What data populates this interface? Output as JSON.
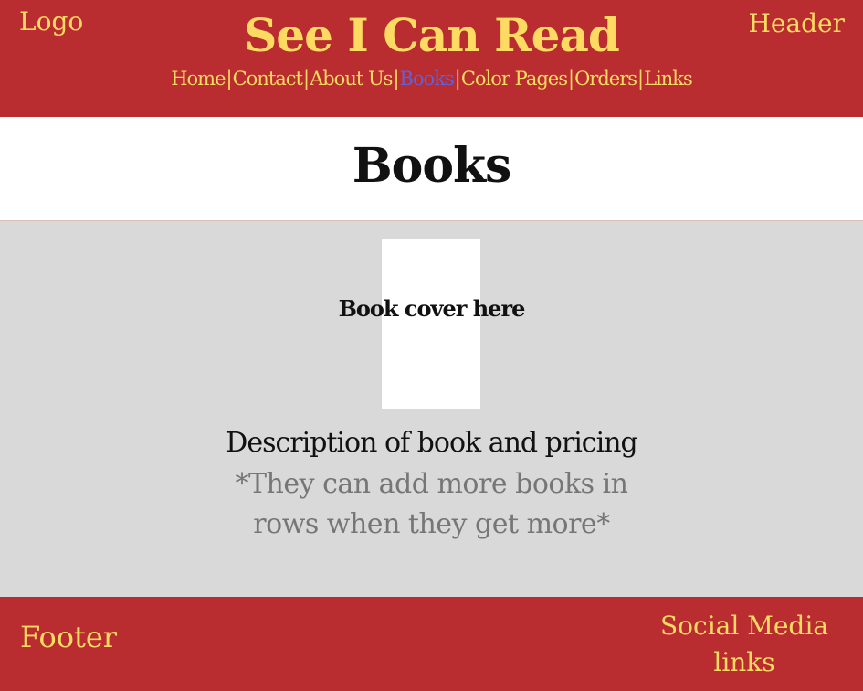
{
  "colors": {
    "header_bg": "#b92c2f",
    "accent_yellow": "#fddb63",
    "active_link": "#5e62e0",
    "content_bg": "#d9d9d9",
    "note_text": "#767676"
  },
  "header": {
    "logo_label": "Logo",
    "header_label": "Header",
    "site_title": "See I Can Read",
    "nav": [
      {
        "label": "Home",
        "active": false
      },
      {
        "label": "Contact",
        "active": false
      },
      {
        "label": "About Us",
        "active": false
      },
      {
        "label": "Books",
        "active": true
      },
      {
        "label": "Color Pages",
        "active": false
      },
      {
        "label": "Orders",
        "active": false
      },
      {
        "label": "Links",
        "active": false
      }
    ],
    "nav_separator": "|"
  },
  "page": {
    "title": "Books"
  },
  "main": {
    "cover_label": "Book cover here",
    "description": "Description of book and pricing",
    "note_lines": [
      "*They can add more books in",
      "rows when they get more*"
    ]
  },
  "footer": {
    "footer_label": "Footer",
    "social_lines": [
      "Social Media",
      "links"
    ]
  }
}
